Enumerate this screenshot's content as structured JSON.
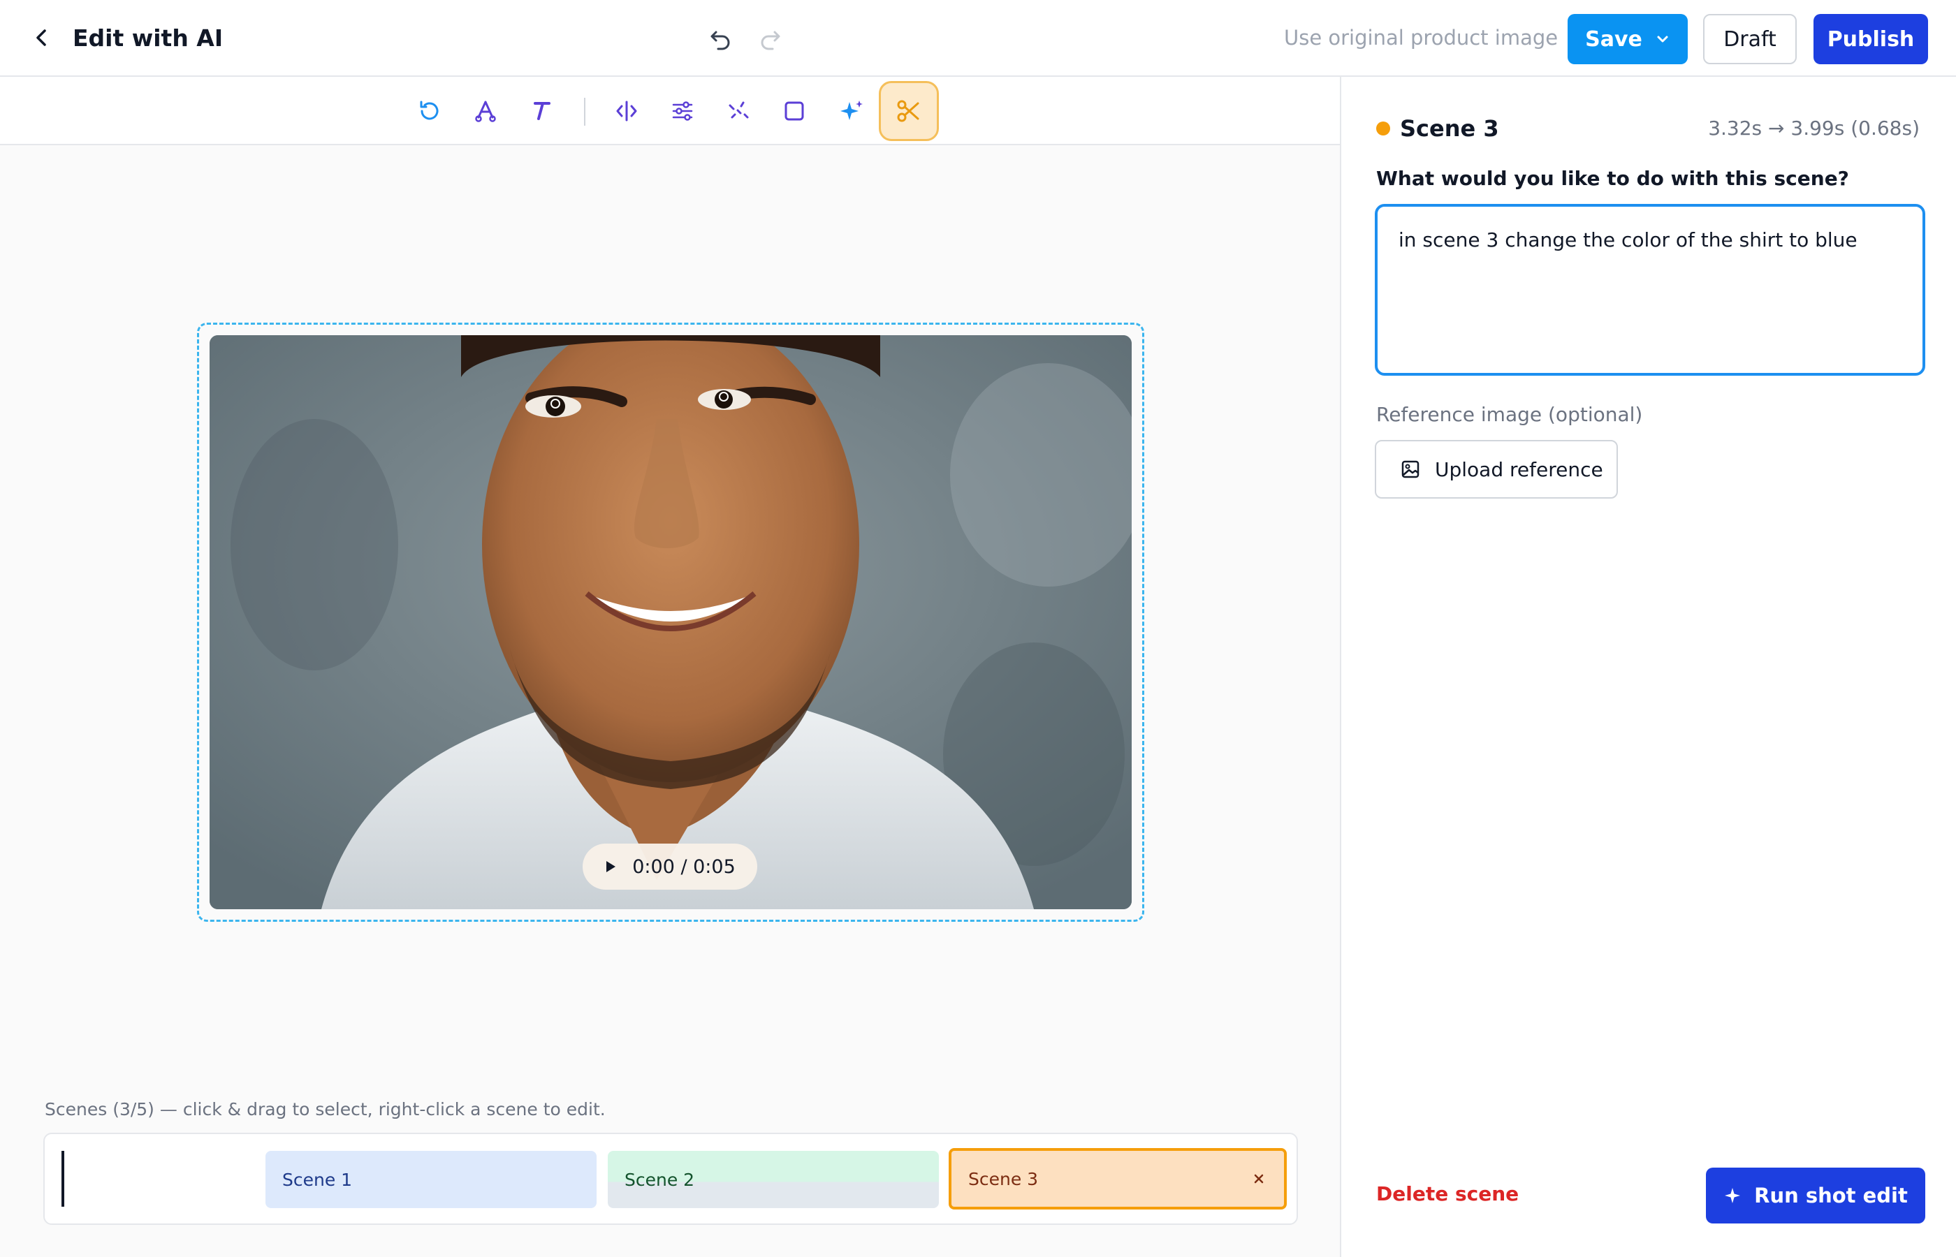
{
  "header": {
    "title": "Edit with AI",
    "use_original_label": "Use original product image",
    "save_label": "Save",
    "draft_label": "Draft",
    "publish_label": "Publish"
  },
  "toolbar": {
    "tools": [
      "rotate-icon",
      "pen-tool-icon",
      "text-icon",
      "flip-icon",
      "adjust-icon",
      "magic-dust-icon",
      "crop-icon",
      "sparkle-icon",
      "scissors-icon"
    ],
    "active_tool": "scissors-icon"
  },
  "player": {
    "time": "0:00 / 0:05"
  },
  "scenes": {
    "hint": "Scenes (3/5) — click & drag to select, right-click a scene to edit.",
    "items": [
      {
        "label": "Scene 1"
      },
      {
        "label": "Scene 2"
      },
      {
        "label": "Scene 3"
      }
    ],
    "selected": "Scene 3"
  },
  "panel": {
    "scene_title": "Scene 3",
    "scene_time": "3.32s → 3.99s (0.68s)",
    "question": "What would you like to do with this scene?",
    "prompt_value": "in scene 3 change the color of the shirt to blue",
    "reference_label": "Reference image (optional)",
    "upload_label": "Upload reference",
    "delete_label": "Delete scene",
    "run_label": "Run shot edit"
  },
  "colors": {
    "primary": "#1d3fe0",
    "save": "#0a93f2",
    "accent_orange": "#f59e0b",
    "danger": "#dc2626",
    "focus_blue": "#1d8ff0"
  }
}
